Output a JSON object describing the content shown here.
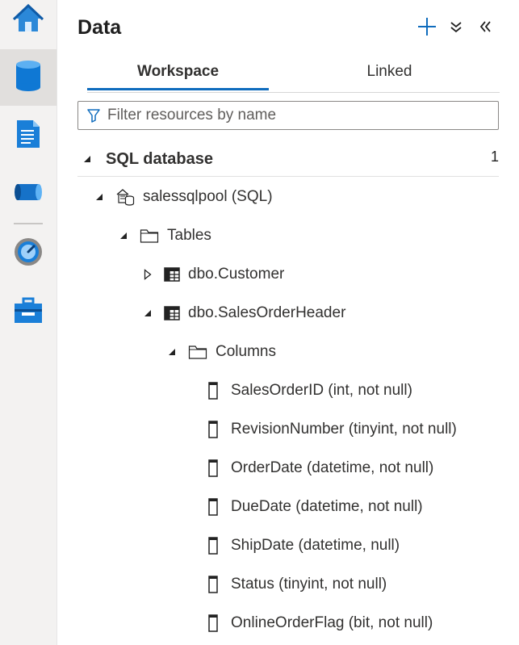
{
  "panel": {
    "title": "Data",
    "actions": {
      "add": "add-icon",
      "collapse_all": "chevron-double-down-icon",
      "close": "chevron-double-left-icon"
    }
  },
  "rail": {
    "items": [
      {
        "name": "home",
        "icon": "home-icon"
      },
      {
        "name": "data",
        "icon": "database-icon",
        "active": true
      },
      {
        "name": "develop",
        "icon": "document-icon"
      },
      {
        "name": "integrate",
        "icon": "pipeline-icon"
      },
      {
        "name": "monitor",
        "icon": "gauge-icon"
      },
      {
        "name": "manage",
        "icon": "toolbox-icon"
      }
    ]
  },
  "tabs": [
    {
      "label": "Workspace",
      "active": true
    },
    {
      "label": "Linked",
      "active": false
    }
  ],
  "filter": {
    "placeholder": "Filter resources by name",
    "value": ""
  },
  "section": {
    "label": "SQL database",
    "count": "1"
  },
  "tree": {
    "pool": "salessqlpool (SQL)",
    "tables_folder": "Tables",
    "tables": [
      "dbo.Customer",
      "dbo.SalesOrderHeader"
    ],
    "columns_folder": "Columns",
    "columns": [
      "SalesOrderID (int, not null)",
      "RevisionNumber (tinyint, not null)",
      "OrderDate (datetime, not null)",
      "DueDate (datetime, not null)",
      "ShipDate (datetime, null)",
      "Status (tinyint, not null)",
      "OnlineOrderFlag (bit, not null)"
    ]
  },
  "colors": {
    "accent": "#0f6cbd",
    "rail_bg": "#f3f2f1",
    "rail_active": "#e1dfdd"
  }
}
